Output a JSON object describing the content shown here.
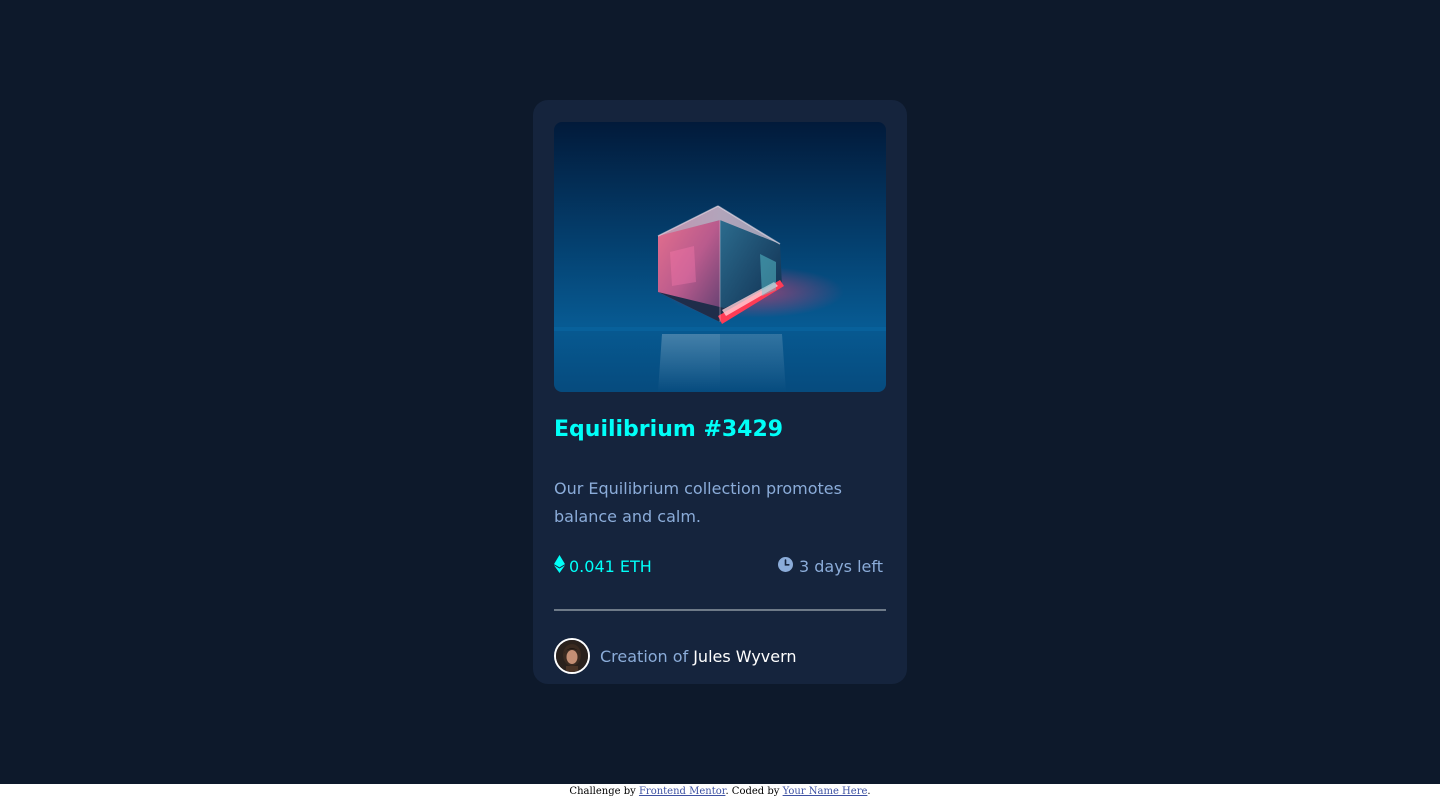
{
  "card": {
    "title": "Equilibrium #3429",
    "description": "Our Equilibrium collection promotes balance and calm.",
    "price": "0.041 ETH",
    "time_left": "3 days left",
    "creator_prefix": "Creation of",
    "creator_name": "Jules Wyvern",
    "image_icon": "equilibrium-cube-image",
    "price_icon": "ethereum-icon",
    "time_icon": "clock-icon",
    "avatar_icon": "creator-avatar"
  },
  "attribution": {
    "prefix": "Challenge by",
    "mentor_link": "Frontend Mentor",
    "middle": ". Coded by",
    "author_link": "Your Name Here",
    "suffix": "."
  },
  "colors": {
    "page_bg": "#0d192b",
    "card_bg": "#15243d",
    "accent_cyan": "#00fff8",
    "soft_blue": "#8bacd9",
    "white": "#ffffff"
  }
}
